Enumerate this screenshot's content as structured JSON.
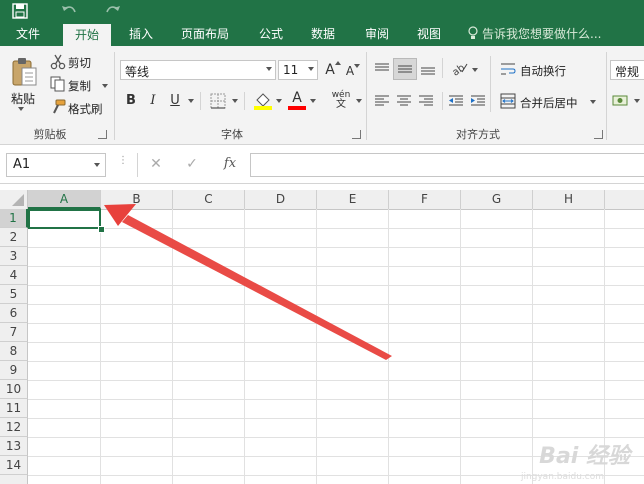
{
  "quick_access": {
    "save_icon": "save-icon",
    "undo_icon": "undo-icon",
    "redo_icon": "redo-icon"
  },
  "tabs": [
    {
      "label": "文件"
    },
    {
      "label": "开始",
      "active": true
    },
    {
      "label": "插入"
    },
    {
      "label": "页面布局"
    },
    {
      "label": "公式"
    },
    {
      "label": "数据"
    },
    {
      "label": "审阅"
    },
    {
      "label": "视图"
    }
  ],
  "tell_me": {
    "icon": "lightbulb-icon",
    "placeholder": "告诉我您想要做什么..."
  },
  "clipboard": {
    "paste_label": "粘贴",
    "cut_label": "剪切",
    "copy_label": "复制",
    "format_painter_label": "格式刷",
    "group_label": "剪贴板"
  },
  "font": {
    "font_name": "等线",
    "font_size": "11",
    "grow_label": "A",
    "shrink_label": "A",
    "bold": "B",
    "italic": "I",
    "underline": "U",
    "font_color_glyph": "A",
    "phonetic_glyph": "wén",
    "group_label": "字体"
  },
  "alignment": {
    "wrap_text_label": "自动换行",
    "merge_center_label": "合并后居中",
    "group_label": "对齐方式"
  },
  "number": {
    "format": "常规"
  },
  "formula_bar": {
    "name_box": "A1",
    "cancel_glyph": "✕",
    "enter_glyph": "✓",
    "fx_glyph": "fx",
    "formula": ""
  },
  "columns": [
    "A",
    "B",
    "C",
    "D",
    "E",
    "F",
    "G",
    "H"
  ],
  "rows": [
    "1",
    "2",
    "3",
    "4",
    "5",
    "6",
    "7",
    "8",
    "9",
    "10",
    "11",
    "12",
    "13",
    "14"
  ],
  "selected_cell": "A1",
  "colors": {
    "excel_green": "#217346",
    "arrow_red": "#e8413c",
    "fill_yellow": "#ffff00",
    "font_red": "#ff0000"
  },
  "watermark": {
    "text": "Bai 经验",
    "sub": "jingyan.baidu.com"
  }
}
